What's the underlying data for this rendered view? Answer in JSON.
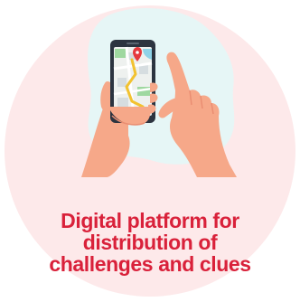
{
  "caption": {
    "line1": "Digital platform for",
    "line2": "distribution of",
    "line3": "challenges and clues"
  },
  "icons": {
    "main": "hand-holding-smartphone-map-icon",
    "pin": "map-pin-icon"
  },
  "colors": {
    "circle_background": "#fde9ea",
    "blob_background": "#e6f6f6",
    "caption_text": "#d9213a",
    "skin": "#f6a889",
    "skin_shadow": "#ea8e72",
    "phone_body": "#2c3440",
    "map_pin": "#e5393c"
  }
}
